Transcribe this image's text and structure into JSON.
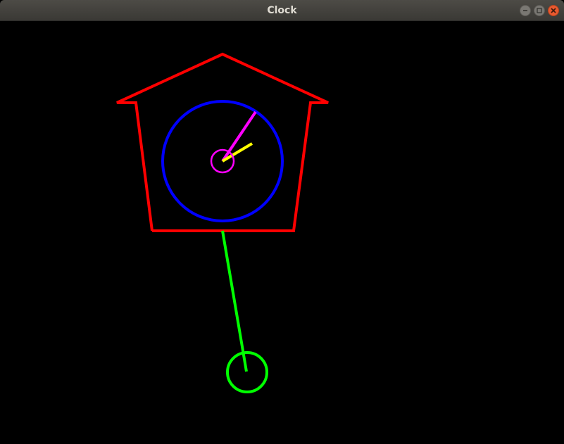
{
  "window": {
    "title": "Clock",
    "controls": {
      "minimize": "minimize-icon",
      "maximize": "maximize-icon",
      "close": "close-icon"
    }
  },
  "colors": {
    "background": "#000000",
    "house_outline": "#ff0000",
    "clock_face": "#0000ff",
    "minute_hand": "#ff00ff",
    "hub": "#ff00ff",
    "hour_hand": "#ffff00",
    "pendulum": "#00ff00"
  }
}
